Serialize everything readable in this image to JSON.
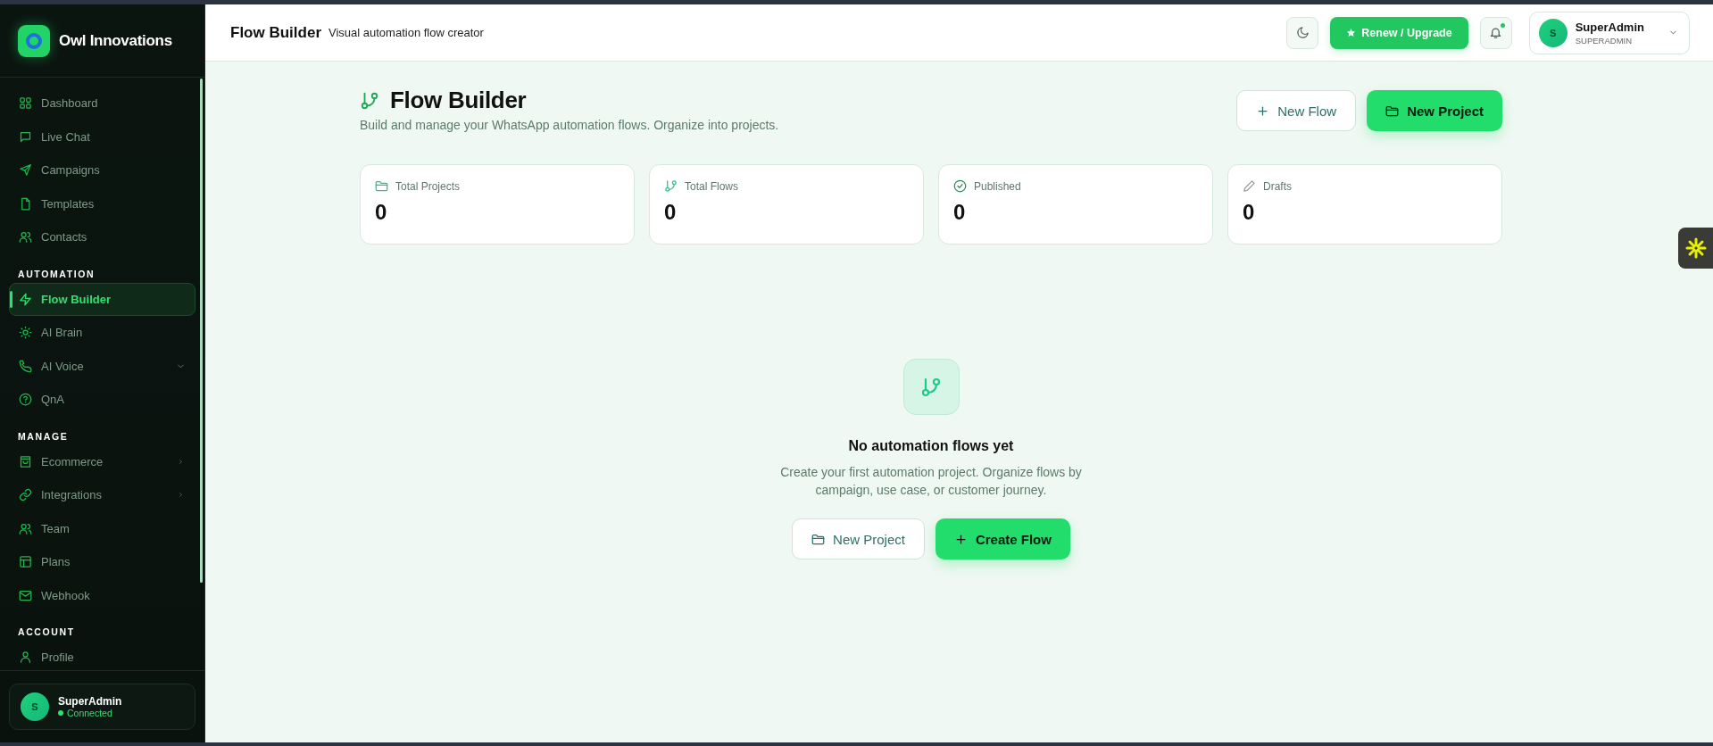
{
  "brand": {
    "name": "Owl Innovations"
  },
  "sidebar": {
    "sections": [
      {
        "items": [
          {
            "label": "Dashboard",
            "selected": false
          },
          {
            "label": "Live Chat",
            "selected": false
          },
          {
            "label": "Campaigns",
            "selected": false
          },
          {
            "label": "Templates",
            "selected": false
          },
          {
            "label": "Contacts",
            "selected": false
          }
        ]
      },
      {
        "heading": "AUTOMATION",
        "items": [
          {
            "label": "Flow Builder",
            "selected": true
          },
          {
            "label": "AI Brain",
            "selected": false
          },
          {
            "label": "AI Voice",
            "selected": false,
            "expandable": true
          },
          {
            "label": "QnA",
            "selected": false
          }
        ]
      },
      {
        "heading": "MANAGE",
        "items": [
          {
            "label": "Ecommerce",
            "selected": false,
            "has_flyout": true
          },
          {
            "label": "Integrations",
            "selected": false,
            "has_flyout": true
          },
          {
            "label": "Team",
            "selected": false
          },
          {
            "label": "Plans",
            "selected": false
          },
          {
            "label": "Webhook",
            "selected": false
          }
        ]
      },
      {
        "heading": "ACCOUNT",
        "items": [
          {
            "label": "Profile",
            "selected": false
          }
        ]
      }
    ],
    "user": {
      "initial": "S",
      "name": "SuperAdmin",
      "status": "Connected"
    }
  },
  "header": {
    "title": "Flow Builder",
    "subtitle": "Visual automation flow creator",
    "upgrade_button": "Renew / Upgrade",
    "notification_dot": true,
    "user": {
      "initial": "S",
      "name": "SuperAdmin",
      "role": "SUPERADMIN"
    }
  },
  "page": {
    "title": "Flow Builder",
    "subtitle": "Build and manage your WhatsApp automation flows. Organize into projects.",
    "buttons": [
      {
        "label": "New Flow",
        "kind": "outline"
      },
      {
        "label": "New Project",
        "kind": "primary"
      }
    ]
  },
  "stats": [
    {
      "label": "Total Projects",
      "value": "0"
    },
    {
      "label": "Total Flows",
      "value": "0"
    },
    {
      "label": "Published",
      "value": "0"
    },
    {
      "label": "Drafts",
      "value": "0"
    }
  ],
  "empty_state": {
    "title": "No automation flows yet",
    "description": "Create your first automation project. Organize flows by campaign, use case, or customer journey.",
    "buttons": [
      {
        "label": "New Project",
        "kind": "outline"
      },
      {
        "label": "Create Flow",
        "kind": "primary"
      }
    ]
  }
}
